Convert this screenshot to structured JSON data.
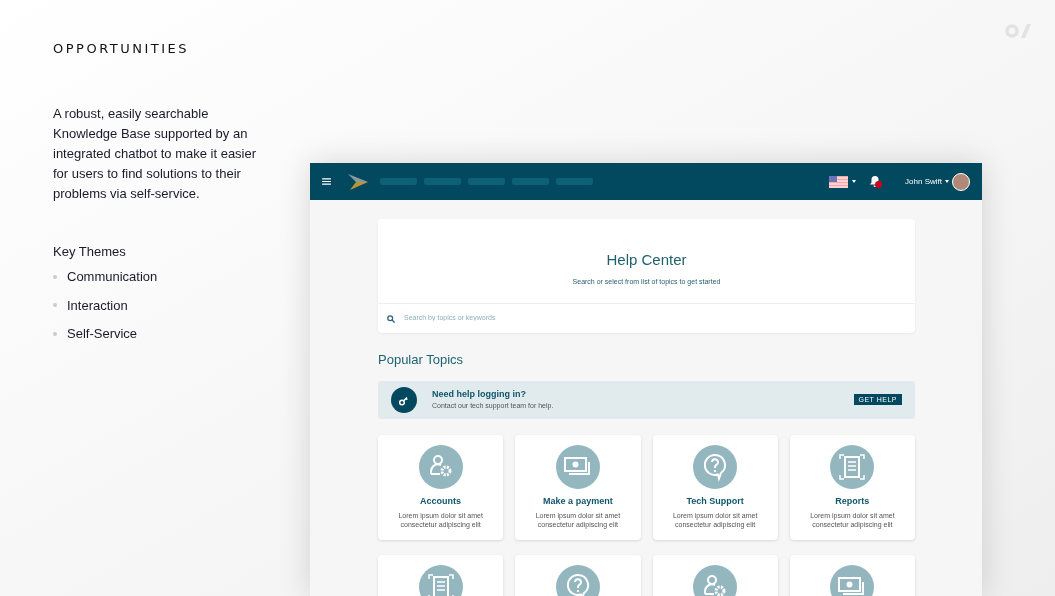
{
  "slide": {
    "heading": "OPPORTUNITIES",
    "summary": "A robust, easily searchable Knowledge Base supported by an integrated chatbot to make it easier for users to find solutions to their problems via self-service.",
    "themes_title": "Key Themes",
    "themes": [
      "Communication",
      "Interaction",
      "Self-Service"
    ]
  },
  "app": {
    "user_name": "John Swift",
    "notifications": true,
    "hero": {
      "title": "Help Center",
      "subtitle": "Search or select from list of topics to get started"
    },
    "search": {
      "placeholder": "Search by topics or keywords"
    },
    "section_title": "Popular Topics",
    "banner": {
      "title": "Need help logging in?",
      "text": "Contact our tech support team for help.",
      "button": "GET HELP"
    },
    "topics": [
      {
        "title": "Accounts",
        "text": "Lorem ipsum dolor sit amet consectetur adipiscing elit"
      },
      {
        "title": "Make a payment",
        "text": "Lorem ipsum dolor sit amet consectetur adipiscing elit"
      },
      {
        "title": "Tech Support",
        "text": "Lorem ipsum dolor sit amet consectetur adipiscing elit"
      },
      {
        "title": "Reports",
        "text": "Lorem ipsum dolor sit amet consectetur adipiscing elit"
      }
    ]
  }
}
